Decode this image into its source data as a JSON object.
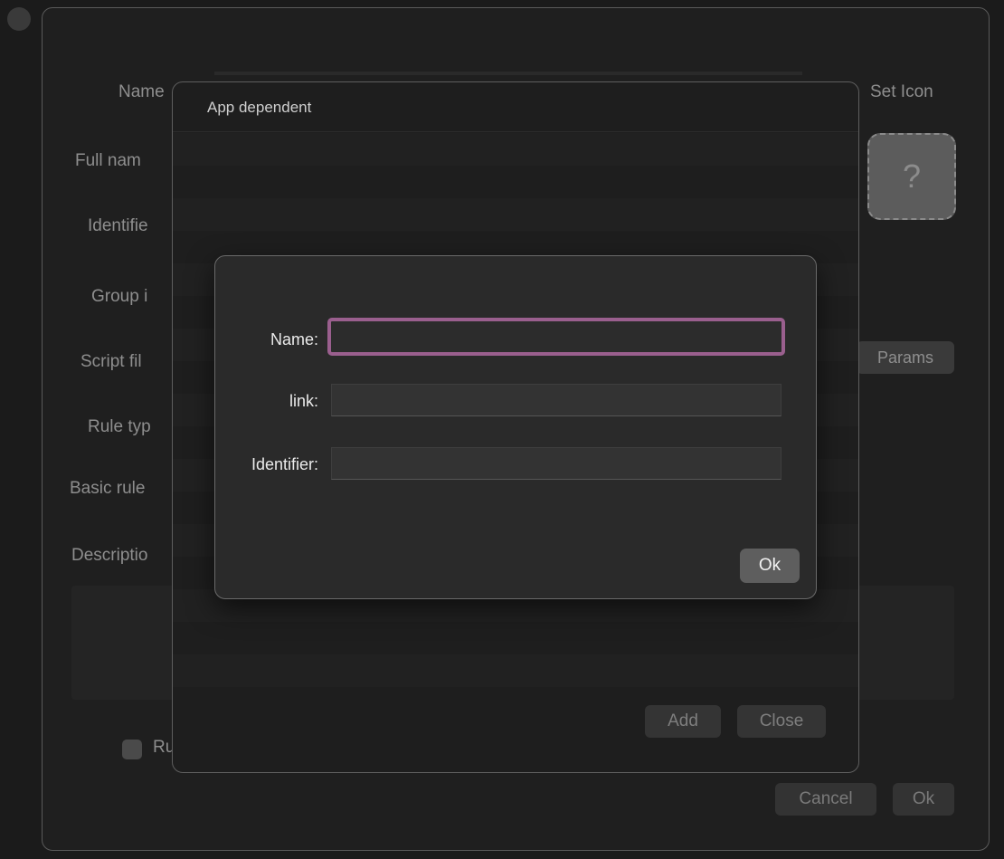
{
  "back_window": {
    "labels": {
      "name": "Name",
      "full_name": "Full nam",
      "identifier": "Identifie",
      "group_id": "Group i",
      "script_file": "Script fil",
      "rule_type": "Rule typ",
      "basic_rule": "Basic rule",
      "description": "Descriptio"
    },
    "set_icon": "Set Icon",
    "icon_placeholder": "?",
    "params_button": "Params",
    "rule_checkbox_label": "Ru",
    "cancel_button": "Cancel",
    "ok_button": "Ok"
  },
  "app_dependent_sheet": {
    "title": "App dependent",
    "add_button": "Add",
    "close_button": "Close"
  },
  "dialog": {
    "name_label": "Name:",
    "name_value": "",
    "link_label": "link:",
    "link_value": "",
    "identifier_label": "Identifier:",
    "identifier_value": "",
    "ok_button": "Ok"
  }
}
